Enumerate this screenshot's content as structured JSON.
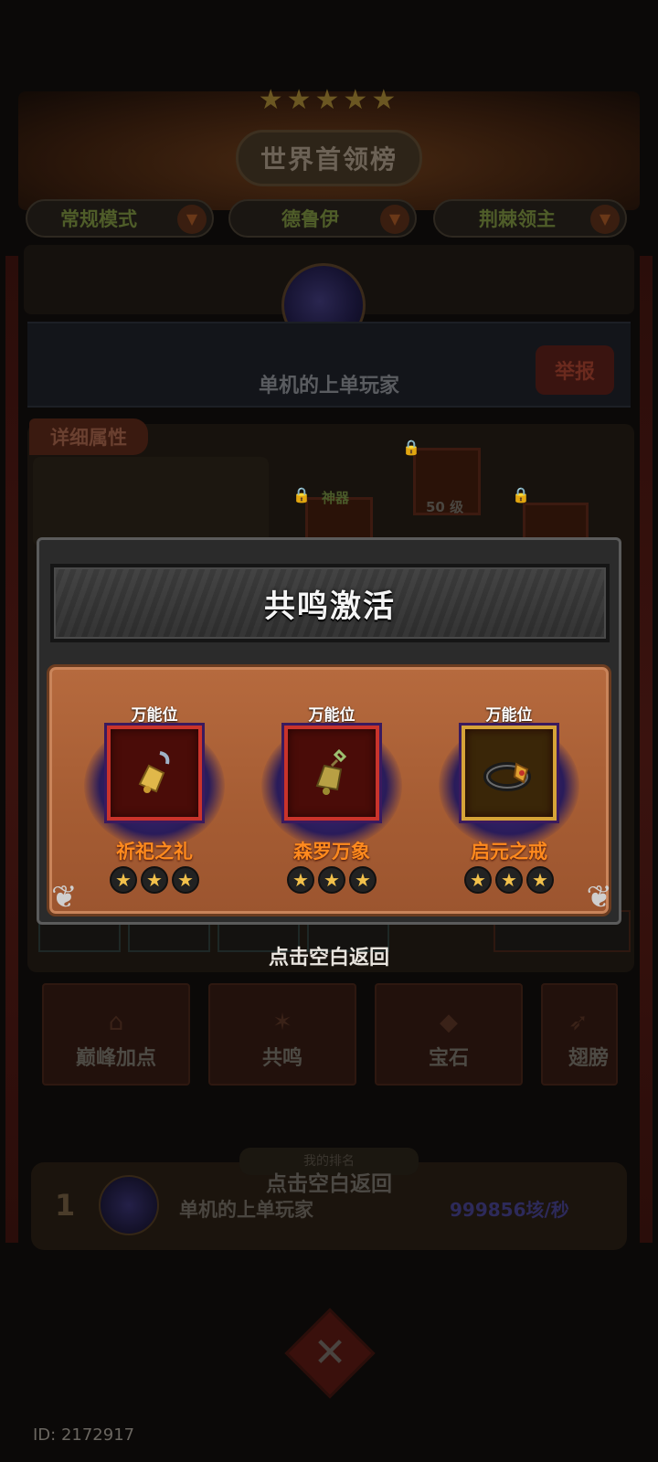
{
  "background": {
    "board_title": "世界首领榜",
    "modes": [
      {
        "label": "常规模式"
      },
      {
        "label": "德鲁伊"
      },
      {
        "label": "荆棘领主"
      }
    ],
    "player_name": "单机的上单玩家",
    "report_label": "举报",
    "detail_tab_label": "详细属性",
    "equip_level_text": "50 级",
    "equip_badge_text": "神器",
    "bottom_tabs": [
      {
        "label": "巅峰加点"
      },
      {
        "label": "共鸣"
      },
      {
        "label": "宝石"
      },
      {
        "label": "翅膀"
      }
    ],
    "my_rank": {
      "tag": "我的排名",
      "rank": "1",
      "name": "单机的上单玩家",
      "score": "999856垓/秒",
      "ghost_hint": "点击空白返回"
    },
    "id_text": "ID: 2172917"
  },
  "modal": {
    "title": "共鸣激活",
    "items": [
      {
        "slot_label": "万能位",
        "name": "祈祀之礼",
        "stars": 3,
        "frame": "red",
        "icon": "bell-icon"
      },
      {
        "slot_label": "万能位",
        "name": "森罗万象",
        "stars": 3,
        "frame": "red",
        "icon": "bell-icon"
      },
      {
        "slot_label": "万能位",
        "name": "启元之戒",
        "stars": 3,
        "frame": "gold",
        "icon": "ring-icon"
      }
    ],
    "dismiss_hint": "点击空白返回"
  },
  "colors": {
    "item_name": "#ff8a1e",
    "frame_red": "#c9332b",
    "frame_gold": "#d6a338",
    "panel_body": "#b66a3e",
    "star": "#f2c14b"
  }
}
